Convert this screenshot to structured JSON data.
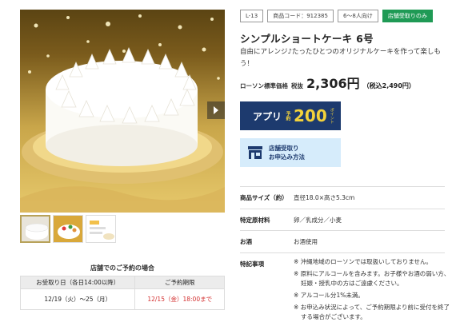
{
  "colors": {
    "green_tag": "#1f9a55",
    "app_button_bg": "#1d3a6e",
    "app_button_accent": "#f3d23b",
    "store_button_bg": "#d6ecfb",
    "deadline_red": "#d32f2f"
  },
  "gallery": {
    "next_icon": "chevron-right-icon"
  },
  "reservation": {
    "title": "店舗でのご予約の場合",
    "col1_header": "お受取り日（各日14:00以降）",
    "col2_header": "ご予約期限",
    "pickup_dates": "12/19（火）～25（月）",
    "deadline": "12/15（金）18:00まで"
  },
  "product": {
    "tags": [
      "L-13",
      "商品コード：912385",
      "6～8人向け",
      "店舗受取りのみ"
    ],
    "title": "シンプルショートケーキ 6号",
    "description": "自由にアレンジ♪たったひとつのオリジナルケーキを作って楽しもう！",
    "price_label": "ローソン標準価格",
    "tax_excl_label": "税抜",
    "price": "2,306円",
    "price_incl": "（税込2,490円）"
  },
  "app_button": {
    "text1": "アプリ",
    "text2": "予約",
    "points": "200",
    "unit": "ポイント"
  },
  "store_button": {
    "icon": "store-icon",
    "line1": "店舗受取り",
    "line2": "お申込み方法"
  },
  "specs": [
    {
      "key": "商品サイズ（約）",
      "value": "直径18.0×高さ5.3cm"
    },
    {
      "key": "特定原材料",
      "value": "卵／乳成分／小麦"
    },
    {
      "key": "お酒",
      "value": "お酒使用"
    },
    {
      "key": "特記事項",
      "value": ""
    }
  ],
  "notes": [
    "※ 沖縄地域のローソンでは取扱いしておりません。",
    "※ 原料にアルコールを含みます。お子様やお酒の弱い方、妊娠・授乳中の方はご遠慮ください。",
    "※ アルコール分1%未満。",
    "※ お申込み状況によって、ご予約期限より前に受付を終了する場合がございます。"
  ]
}
